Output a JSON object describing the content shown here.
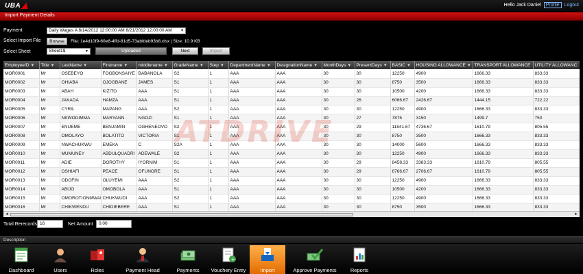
{
  "header": {
    "logo": "UBA",
    "greeting": "Hello Jack Daniel",
    "profile_link": "Profile",
    "logout_link": "Logout"
  },
  "section_title": "Import Payment Details",
  "form": {
    "payment_label": "Payment",
    "payment_value": "Daily Wages A 8/14/2012 12:00:00 AM 8/21/2012 12:00:00 AM",
    "import_file_label": "Select Import File",
    "browse_label": "Browse",
    "file_info": "File: 1e4d10f9-60e6-4ffd-81d5-73abfdeb93b8.xlsx | Size: 10.9 KB",
    "sheet_label": "Select Sheet",
    "sheet_value": "Sheet1$",
    "status_label": "Uploaded",
    "next_label": "Next",
    "import_label": "Import"
  },
  "grid": {
    "columns": [
      "EmployeeID",
      "Title",
      "LastName",
      "Firstname",
      "middlename",
      "GradeName",
      "Step",
      "DepartmentName",
      "DesignationName",
      "MonthDays",
      "PresentDays",
      "BASIC",
      "HOUSING ALLOWANCE",
      "TRANSPORT ALLOWANCE",
      "UTILITY ALLOWANC"
    ],
    "rows": [
      [
        "MOR0001",
        "Mr",
        "OSEBEYO",
        "FOGBONSAIYE",
        "BABANOLA",
        "S2",
        "1",
        "AAA",
        "AAA",
        "30",
        "30",
        "12250",
        "4900",
        "1666.33",
        "833.33"
      ],
      [
        "MOR0002",
        "Mr",
        "OHIABA",
        "OJOGBANE",
        "JAMES",
        "S1",
        "1",
        "AAA",
        "AAA",
        "30",
        "30",
        "8750",
        "3500",
        "1666.33",
        "833.33"
      ],
      [
        "MOR0003",
        "Mr",
        "ABAH",
        "KIZITO",
        "AAA",
        "S1",
        "1",
        "AAA",
        "AAA",
        "30",
        "30",
        "10500",
        "4200",
        "1666.33",
        "833.33"
      ],
      [
        "MOR0004",
        "Mr",
        "JAKADA",
        "HAMZA",
        "AAA",
        "S1",
        "1",
        "AAA",
        "AAA",
        "30",
        "26",
        "6066.67",
        "2426.67",
        "1444.15",
        "722.22"
      ],
      [
        "MOR0005",
        "Mr",
        "CYRIL",
        "MAPANG",
        "AAA",
        "S2",
        "1",
        "AAA",
        "AAA",
        "30",
        "30",
        "12250",
        "4900",
        "1666.33",
        "833.33"
      ],
      [
        "MOR0006",
        "Mr",
        "NKWODIMMA",
        "MARYANN",
        "NGOZI",
        "S1",
        "1",
        "AAA",
        "AAA",
        "30",
        "27",
        "7875",
        "3150",
        "1499.7",
        "750"
      ],
      [
        "MOR0007",
        "Mr",
        "ENUEME",
        "BENJAMIN",
        "OGHENEOVO",
        "S2",
        "1",
        "AAA",
        "AAA",
        "30",
        "29",
        "11841.67",
        "4736.67",
        "1610.79",
        "805.55"
      ],
      [
        "MOR0008",
        "Mr",
        "OMOLAYO",
        "BOLATITO",
        "VICTORIA",
        "S1",
        "1",
        "AAA",
        "AAA",
        "30",
        "30",
        "8750",
        "3500",
        "1666.33",
        "833.33"
      ],
      [
        "MOR0009",
        "Mr",
        "NWACHUKWU",
        "EMEKA",
        "C",
        "S2A",
        "1",
        "AAA",
        "AAA",
        "30",
        "30",
        "14000",
        "5600",
        "1666.33",
        "833.33"
      ],
      [
        "MOR0010",
        "Mr",
        "MUMUNEY",
        "ABDULQUADRI",
        "ADEWALE",
        "S2",
        "1",
        "AAA",
        "AAA",
        "30",
        "30",
        "12250",
        "4900",
        "1666.33",
        "833.33"
      ],
      [
        "MOR0011",
        "Mr",
        "ADIE",
        "DOROTHY",
        "IYORNIM",
        "S1",
        "1",
        "AAA",
        "AAA",
        "30",
        "29",
        "8458.33",
        "3383.33",
        "1610.79",
        "805.55"
      ],
      [
        "MOR0012",
        "Mr",
        "OSHIAFI",
        "PEACE",
        "OFUNORE",
        "S1",
        "1",
        "AAA",
        "AAA",
        "30",
        "29",
        "6766.67",
        "2706.67",
        "1610.79",
        "805.55"
      ],
      [
        "MOR0013",
        "Mr",
        "ODOFIN",
        "OLUYEMI",
        "AAA",
        "S2",
        "1",
        "AAA",
        "AAA",
        "30",
        "30",
        "12250",
        "4900",
        "1666.33",
        "833.33"
      ],
      [
        "MOR0014",
        "Mr",
        "ABIJO",
        "OMOBOLA",
        "AAA",
        "S1",
        "1",
        "AAA",
        "AAA",
        "30",
        "30",
        "10500",
        "4200",
        "1666.33",
        "833.33"
      ],
      [
        "MOR0015",
        "Mr",
        "OMOROTIONMWAN",
        "CHUKWUDI",
        "AAA",
        "S2",
        "1",
        "AAA",
        "AAA",
        "30",
        "30",
        "12250",
        "4900",
        "1666.33",
        "833.33"
      ],
      [
        "MOR0016",
        "Mr",
        "CHIKWENDU",
        "CHIDIEBERE",
        "AAA",
        "S1",
        "1",
        "AAA",
        "AAA",
        "30",
        "30",
        "8750",
        "3500",
        "1666.33",
        "833.33"
      ]
    ],
    "watermark": "ATDRIVE"
  },
  "totals": {
    "records_label": "Total Rerecords",
    "records_value": "16",
    "amount_label": "Net Amount",
    "amount_value": "0.00"
  },
  "description_label": "Description",
  "dock": [
    {
      "label": "Dashboard",
      "icon": "dashboard-icon",
      "active": false
    },
    {
      "label": "Users",
      "icon": "user-icon",
      "active": false
    },
    {
      "label": "Roles",
      "icon": "roles-icon",
      "active": false
    },
    {
      "label": "Payment Head",
      "icon": "payment-head-icon",
      "active": false
    },
    {
      "label": "Payments",
      "icon": "payments-icon",
      "active": false
    },
    {
      "label": "Vouchery Entry",
      "icon": "voucher-entry-icon",
      "active": false
    },
    {
      "label": "Import",
      "icon": "import-icon",
      "active": true
    },
    {
      "label": "Approve Payments",
      "icon": "approve-payments-icon",
      "active": false
    },
    {
      "label": "Reports",
      "icon": "reports-icon",
      "active": false
    }
  ],
  "colors": {
    "brand_red": "#c00000",
    "active_tab": "#f08a1c",
    "link_blue": "#7fb7ff"
  }
}
